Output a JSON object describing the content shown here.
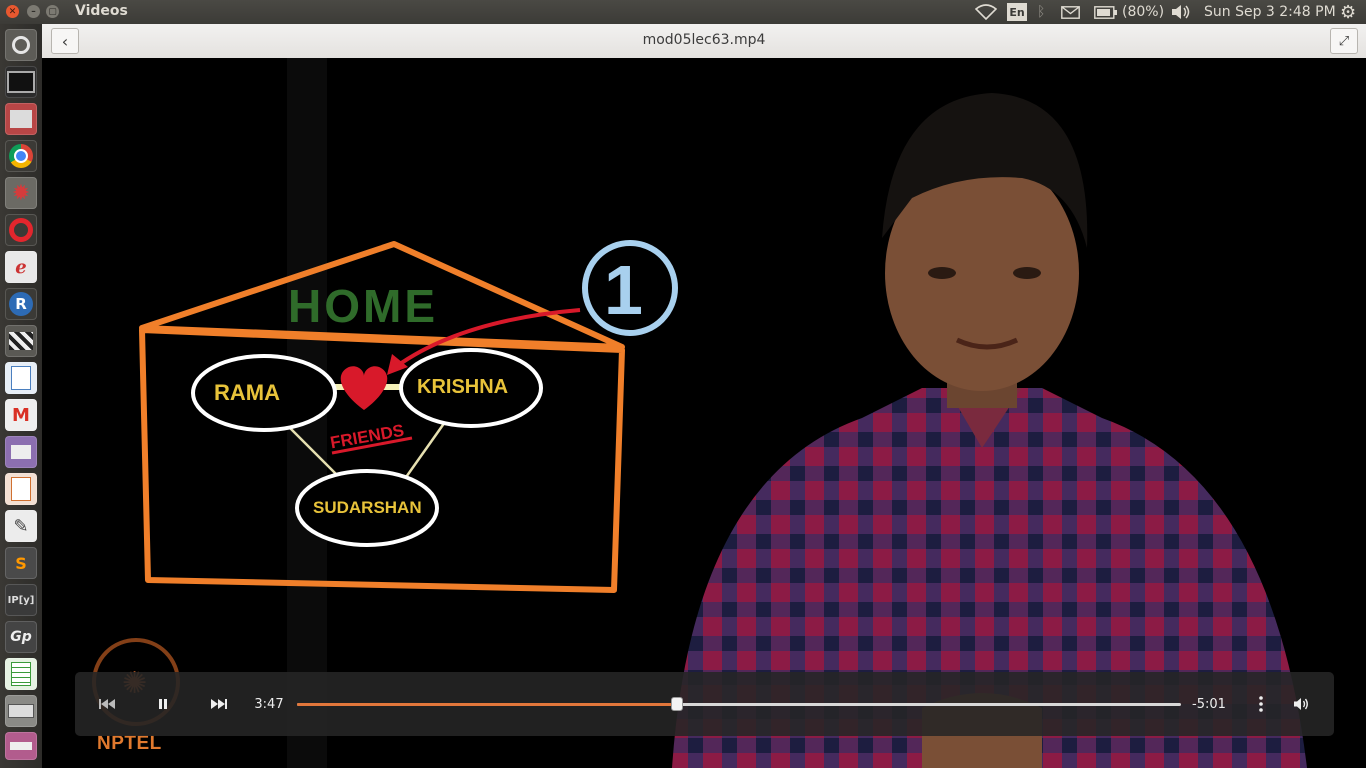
{
  "system_panel": {
    "app_name": "Videos",
    "keyboard_layout": "En",
    "battery": "(80%)",
    "clock": "Sun Sep  3  2:48 PM",
    "icons": [
      "wifi-icon",
      "bluetooth-icon",
      "mail-icon",
      "battery-icon",
      "volume-icon",
      "settings-gear-icon"
    ]
  },
  "launcher": {
    "items": [
      {
        "name": "launcher-dash",
        "icon": "ubuntu-logo-icon"
      },
      {
        "name": "launcher-terminal",
        "icon": "terminal-icon"
      },
      {
        "name": "launcher-archive",
        "icon": "archive-icon"
      },
      {
        "name": "launcher-chrome",
        "icon": "chrome-icon"
      },
      {
        "name": "launcher-settings",
        "icon": "gear-app-icon"
      },
      {
        "name": "launcher-opera",
        "icon": "opera-icon"
      },
      {
        "name": "launcher-evince",
        "icon": "document-viewer-icon"
      },
      {
        "name": "launcher-r",
        "icon": "r-icon"
      },
      {
        "name": "launcher-video",
        "icon": "clapper-icon"
      },
      {
        "name": "launcher-writer",
        "icon": "text-document-icon"
      },
      {
        "name": "launcher-gmail",
        "icon": "gmail-icon"
      },
      {
        "name": "launcher-media",
        "icon": "media-icon"
      },
      {
        "name": "launcher-presentation",
        "icon": "presentation-icon"
      },
      {
        "name": "launcher-text-editor",
        "icon": "text-editor-icon"
      },
      {
        "name": "launcher-sublime",
        "icon": "sublime-icon"
      },
      {
        "name": "launcher-ipython",
        "icon": "ipython-icon"
      },
      {
        "name": "launcher-geogebra",
        "icon": "geogebra-icon"
      },
      {
        "name": "launcher-spreadsheet",
        "icon": "spreadsheet-icon"
      },
      {
        "name": "launcher-drive",
        "icon": "drive-icon"
      },
      {
        "name": "launcher-more",
        "icon": "apps-icon"
      }
    ],
    "labels": {
      "r": "R",
      "sublime": "S",
      "ipython": "IP[y]",
      "geogebra": "Gp"
    }
  },
  "header": {
    "file_title": "mod05lec63.mp4",
    "back_icon": "chevron-left-icon",
    "fullscreen_icon": "fullscreen-icon"
  },
  "video_frame": {
    "board_title": "HOME",
    "nodes": [
      "RAMA",
      "KRISHNA",
      "SUDARSHAN"
    ],
    "edge_label": "FRIENDS",
    "badge": "1",
    "watermark": "NPTEL"
  },
  "player": {
    "elapsed": "3:47",
    "remaining": "-5:01",
    "progress": 0.43,
    "icons": [
      "skip-back-icon",
      "pause-icon",
      "skip-forward-icon",
      "more-vertical-icon",
      "volume-icon"
    ]
  },
  "colors": {
    "accent": "#e2773b",
    "house": "#f07f2a",
    "home_text": "#2f6b2a",
    "node_text": "#e8c33a",
    "heart": "#d8192a",
    "badge": "#a8d0ee"
  }
}
